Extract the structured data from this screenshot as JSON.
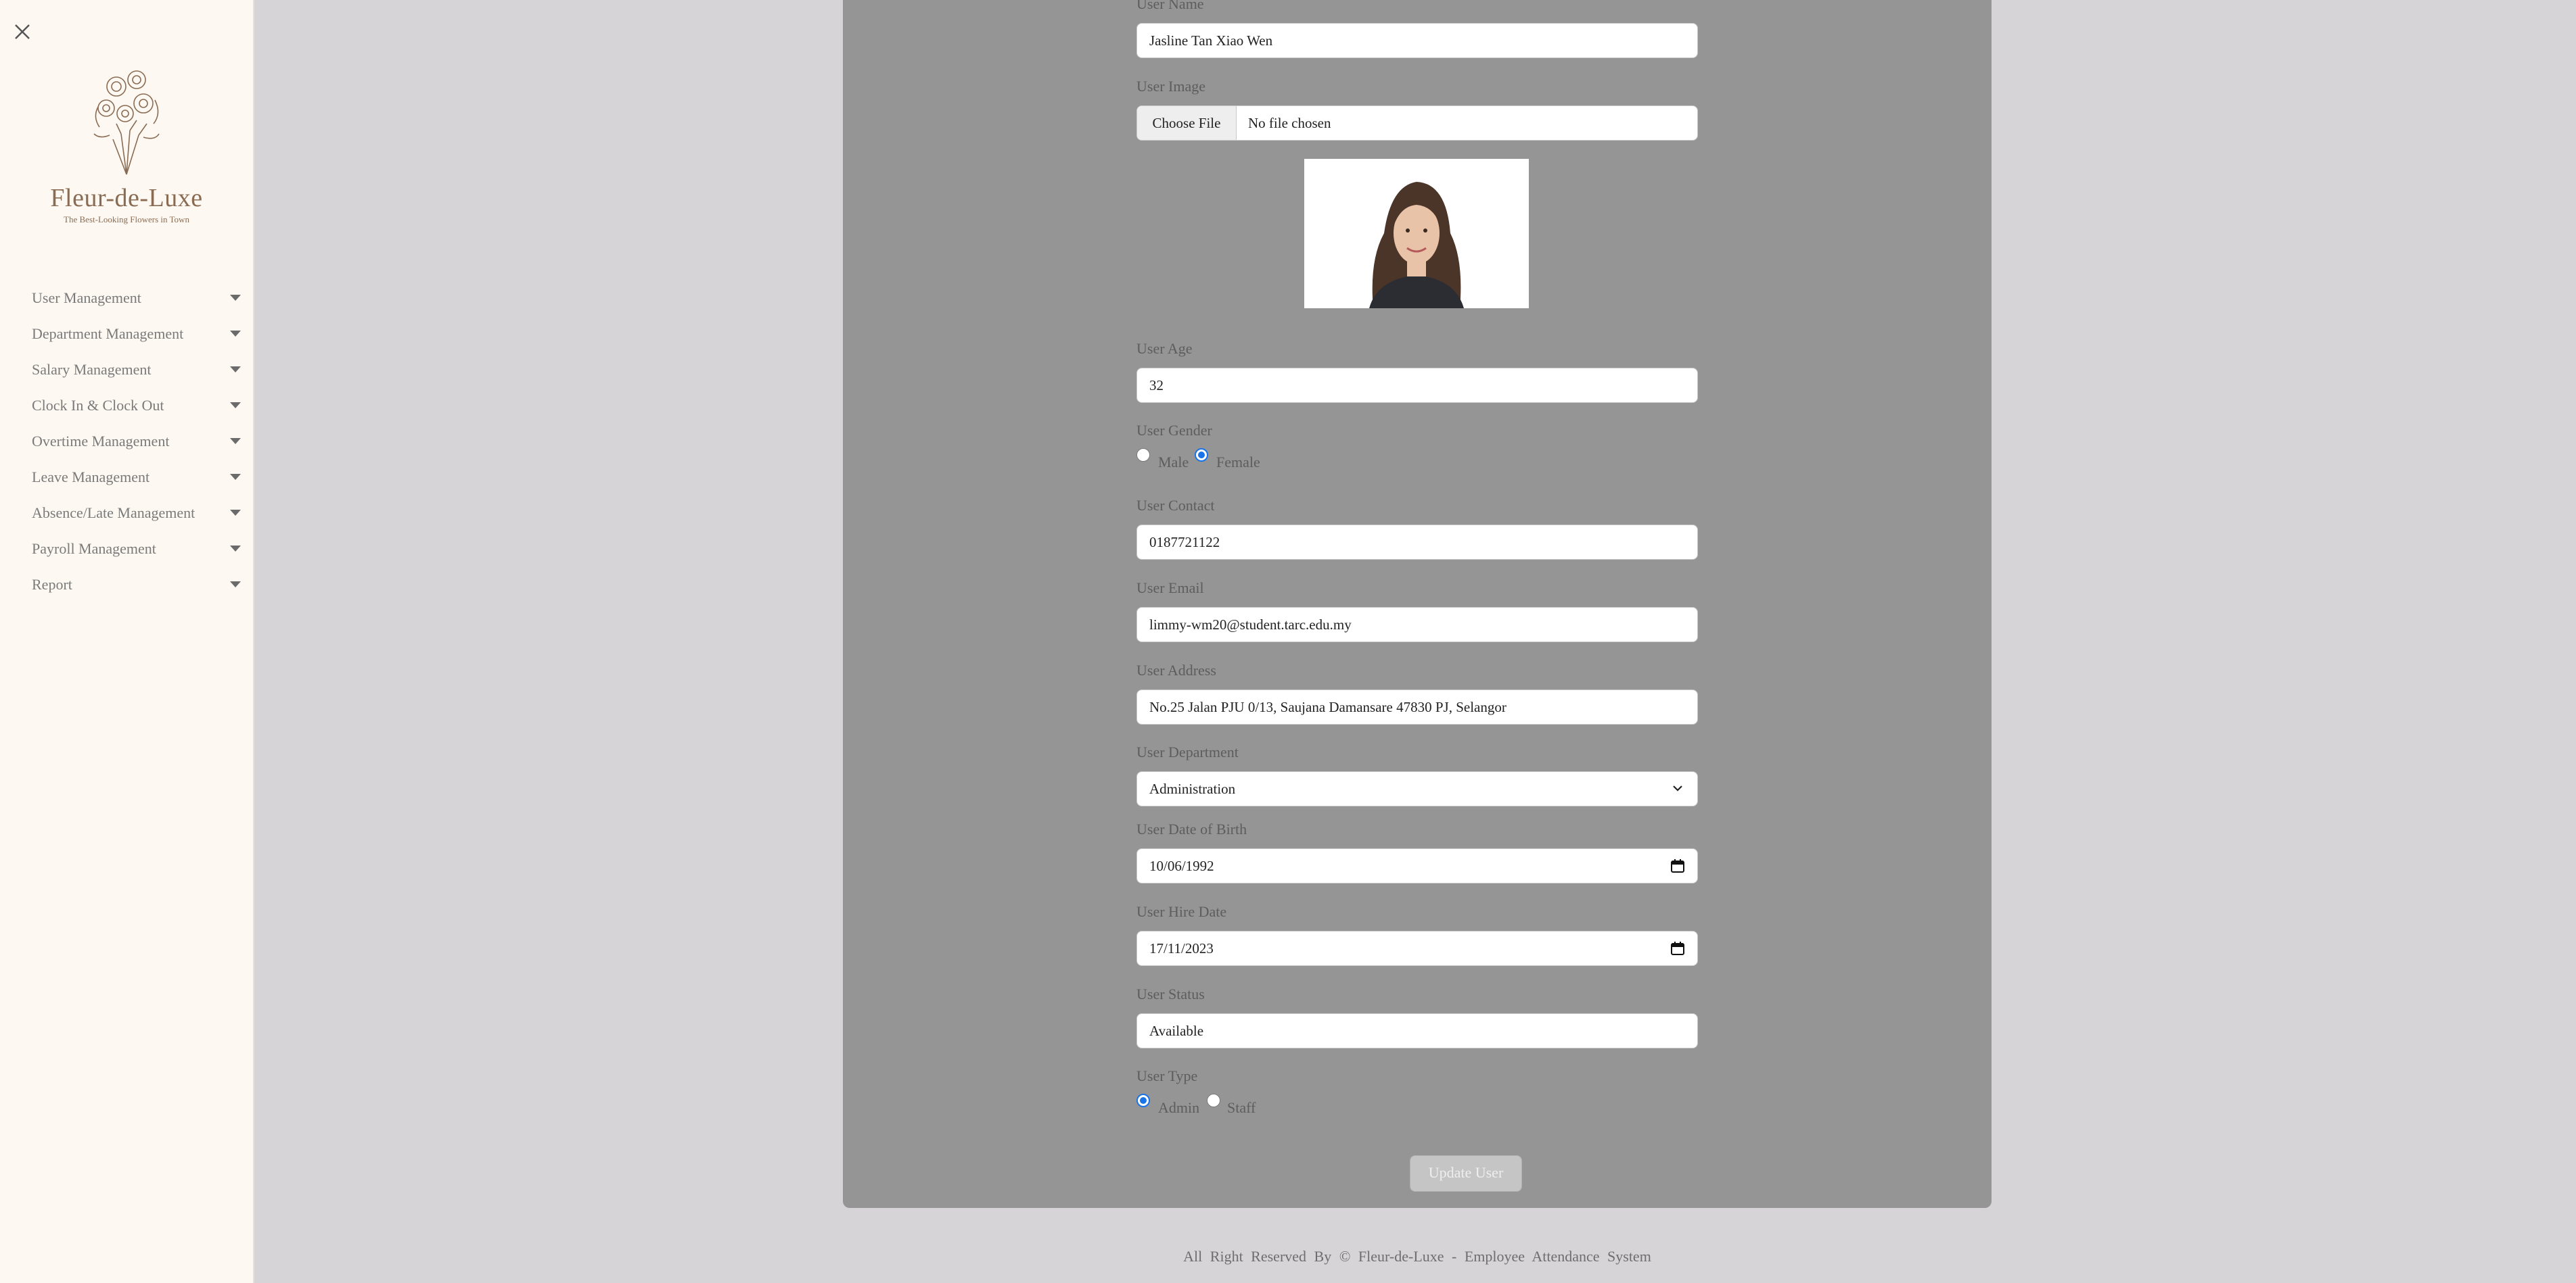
{
  "sidebar": {
    "brand": {
      "title": "Fleur-de-Luxe",
      "tagline": "The Best-Looking Flowers in Town"
    },
    "items": [
      {
        "label": "User Management",
        "name": "sidebar-item-user-management"
      },
      {
        "label": "Department Management",
        "name": "sidebar-item-department-management"
      },
      {
        "label": "Salary Management",
        "name": "sidebar-item-salary-management"
      },
      {
        "label": "Clock In & Clock Out",
        "name": "sidebar-item-clock-in-out"
      },
      {
        "label": "Overtime Management",
        "name": "sidebar-item-overtime-management"
      },
      {
        "label": "Leave Management",
        "name": "sidebar-item-leave-management"
      },
      {
        "label": "Absence/Late Management",
        "name": "sidebar-item-absence-late-management"
      },
      {
        "label": "Payroll Management",
        "name": "sidebar-item-payroll-management"
      },
      {
        "label": "Report",
        "name": "sidebar-item-report"
      }
    ]
  },
  "form": {
    "user_name": {
      "label": "User Name",
      "value": "Jasline Tan Xiao Wen"
    },
    "user_image": {
      "label": "User Image",
      "button": "Choose File",
      "status": "No file chosen"
    },
    "user_age": {
      "label": "User Age",
      "value": "32"
    },
    "user_gender": {
      "label": "User Gender",
      "options": [
        "Male",
        "Female"
      ],
      "selected": "Female"
    },
    "user_contact": {
      "label": "User Contact",
      "value": "0187721122"
    },
    "user_email": {
      "label": "User Email",
      "value": "limmy-wm20@student.tarc.edu.my"
    },
    "user_address": {
      "label": "User Address",
      "value": "No.25 Jalan PJU 0/13, Saujana Damansare 47830 PJ, Selangor"
    },
    "user_department": {
      "label": "User Department",
      "value": "Administration"
    },
    "user_dob": {
      "label": "User Date of Birth",
      "value": "10/06/1992"
    },
    "user_hire_date": {
      "label": "User Hire Date",
      "value": "17/11/2023"
    },
    "user_status": {
      "label": "User Status",
      "value": "Available"
    },
    "user_type": {
      "label": "User Type",
      "options": [
        "Admin",
        "Staff"
      ],
      "selected": "Admin"
    },
    "submit_label": "Update User"
  },
  "footer": {
    "text": "All Right Reserved By © Fleur-de-Luxe - Employee Attendance System"
  },
  "colors": {
    "sidebar_bg": "#fdf8f1",
    "panel_bg": "#959595",
    "page_bg": "#d6d4d6",
    "accent": "#1a73e8",
    "brand": "#8a6c54"
  }
}
